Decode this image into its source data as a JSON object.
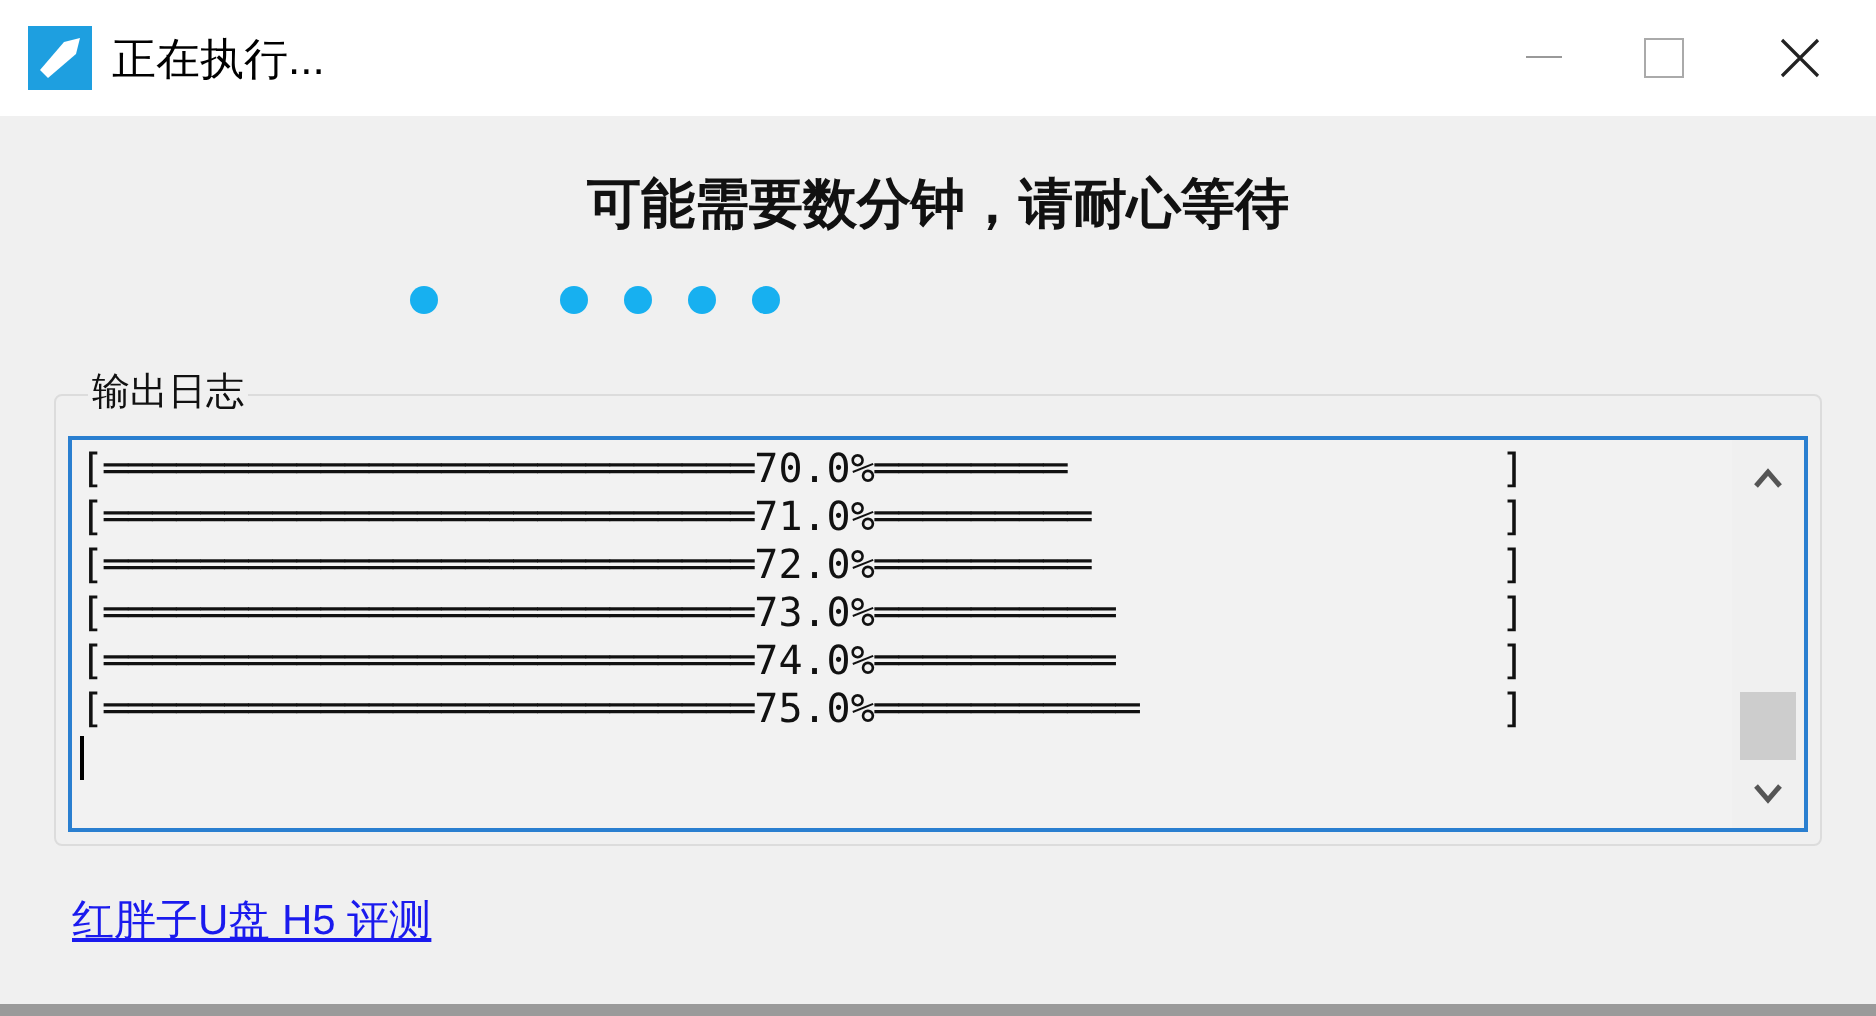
{
  "window": {
    "title": "正在执行..."
  },
  "heading": "可能需要数分钟，请耐心等待",
  "log": {
    "title": "输出日志",
    "lines": [
      "[═══════════════════════════70.0%════════                  ]",
      "[═══════════════════════════71.0%═════════                 ]",
      "[═══════════════════════════72.0%═════════                 ]",
      "[═══════════════════════════73.0%══════════                ]",
      "[═══════════════════════════74.0%══════════                ]",
      "[═══════════════════════════75.0%═══════════               ]"
    ]
  },
  "link": "红胖子U盘 H5 评测"
}
